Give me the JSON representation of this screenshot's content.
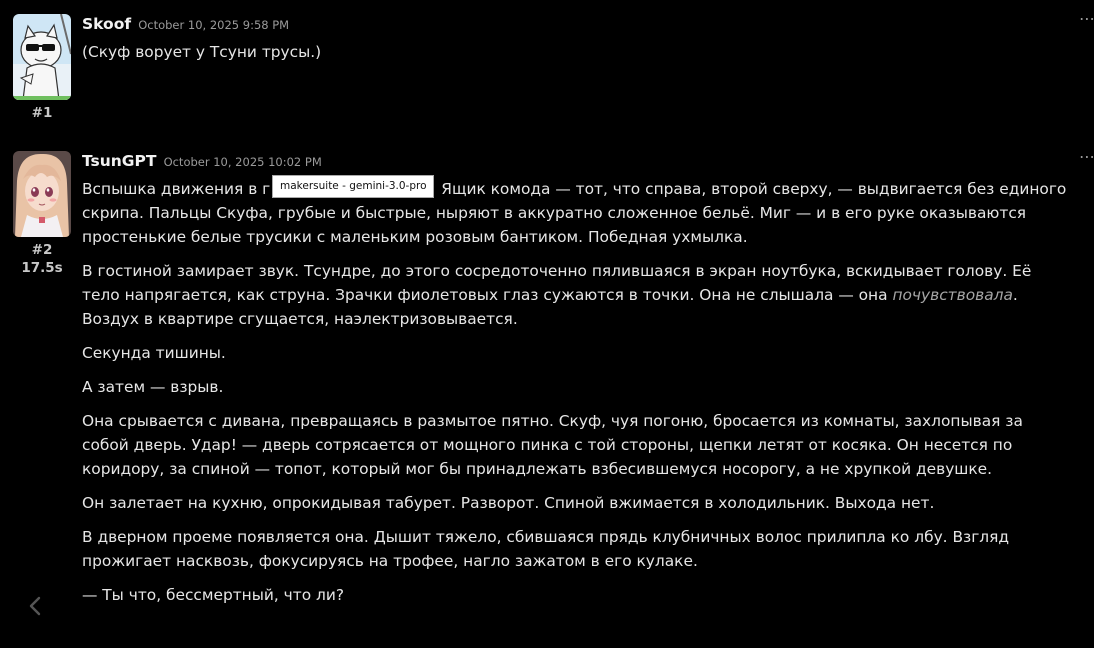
{
  "messages": [
    {
      "index": "#1",
      "author": "Skoof",
      "timestamp": "October 10, 2025 9:58 PM",
      "avatar": "meme-cat-sunglasses-avatar",
      "paragraphs": [
        "(Скуф ворует у Тсуни трусы.)"
      ]
    },
    {
      "index": "#2",
      "time_taken": "17.5s",
      "author": "TsunGPT",
      "timestamp": "October 10, 2025 10:02 PM",
      "avatar": "anime-girl-avatar",
      "paragraphs": [
        "Вспышка движения в г",
        "Ящик комода — тот, что справа, второй сверху, — выдвигается без единого скрипа. Пальцы Скуфа, грубые и быстрые, ныряют в аккуратно сложенное бельё. Миг — и в его руке оказываются простенькие белые трусики с маленьким розовым бантиком. Победная ухмылка.",
        "В гостиной замирает звук. Тсундре, до этого сосредоточенно пялившаяся в экран ноутбука, вскидывает голову. Её тело напрягается, как струна. Зрачки фиолетовых глаз сужаются в точки. Она не слышала — она ",
        "почувствовала",
        ". Воздух в квартире сгущается, наэлектризовывается.",
        "Секунда тишины.",
        "А затем — взрыв.",
        "Она срывается с дивана, превращаясь в размытое пятно. Скуф, чуя погоню, бросается из комнаты, захлопывая за собой дверь. Удар! — дверь сотрясается от мощного пинка с той стороны, щепки летят от косяка. Он несется по коридору, за спиной — топот, который мог бы принадлежать взбесившемуся носорогу, а не хрупкой девушке.",
        "Он залетает на кухню, опрокидывая табурет. Разворот. Спиной вжимается в холодильник. Выхода нет.",
        "В дверном проеме появляется она. Дышит тяжело, сбившаяся прядь клубничных волос прилипла ко лбу. Взгляд прожигает насквозь, фокусируясь на трофее, нагло зажатом в его кулаке.",
        "— Ты что, бессмертный, что ли?"
      ]
    }
  ],
  "tooltip": {
    "text": "makersuite - gemini-3.0-pro"
  },
  "icons": {
    "more": "more-options-icon",
    "prev": "chevron-left-icon"
  },
  "colors": {
    "background": "#000000",
    "text": "#e6e6e6",
    "muted": "#9a9a9a",
    "tooltip_bg": "#ffffff"
  }
}
